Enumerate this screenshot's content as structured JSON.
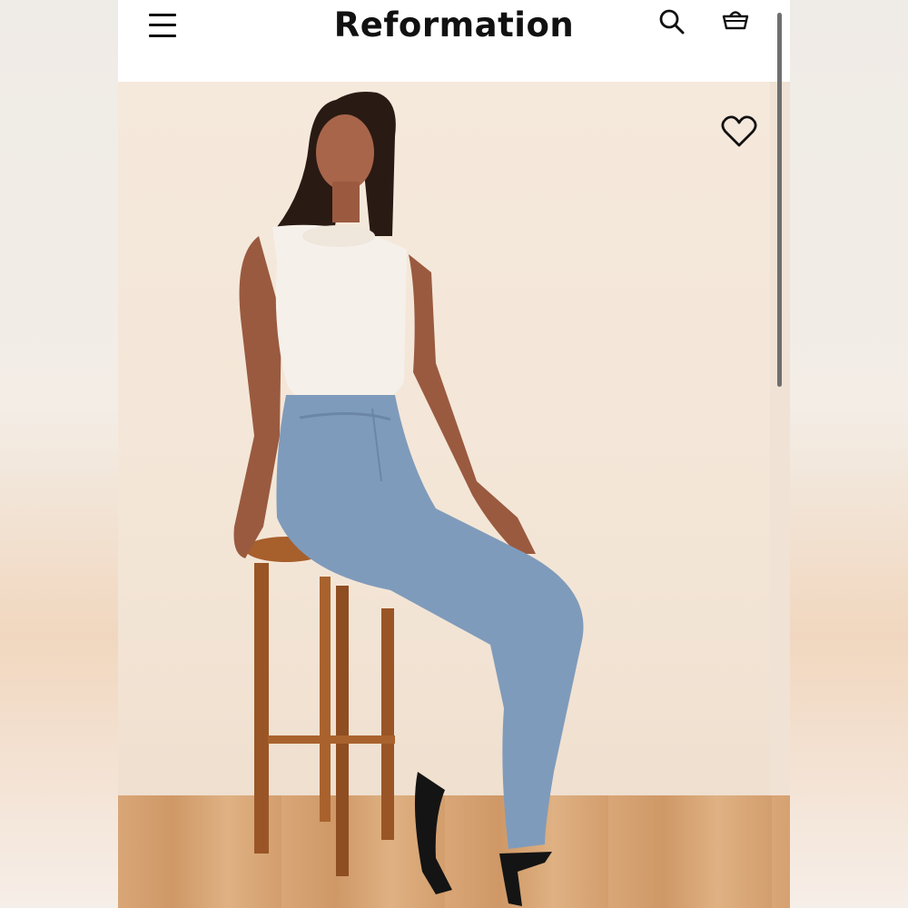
{
  "header": {
    "brand": "Reformation"
  },
  "icons": {
    "menu": "hamburger-menu-icon",
    "search": "search-icon",
    "cart": "basket-icon",
    "wishlist": "heart-icon"
  },
  "colors": {
    "text": "#111111",
    "header_bg": "#ffffff"
  }
}
